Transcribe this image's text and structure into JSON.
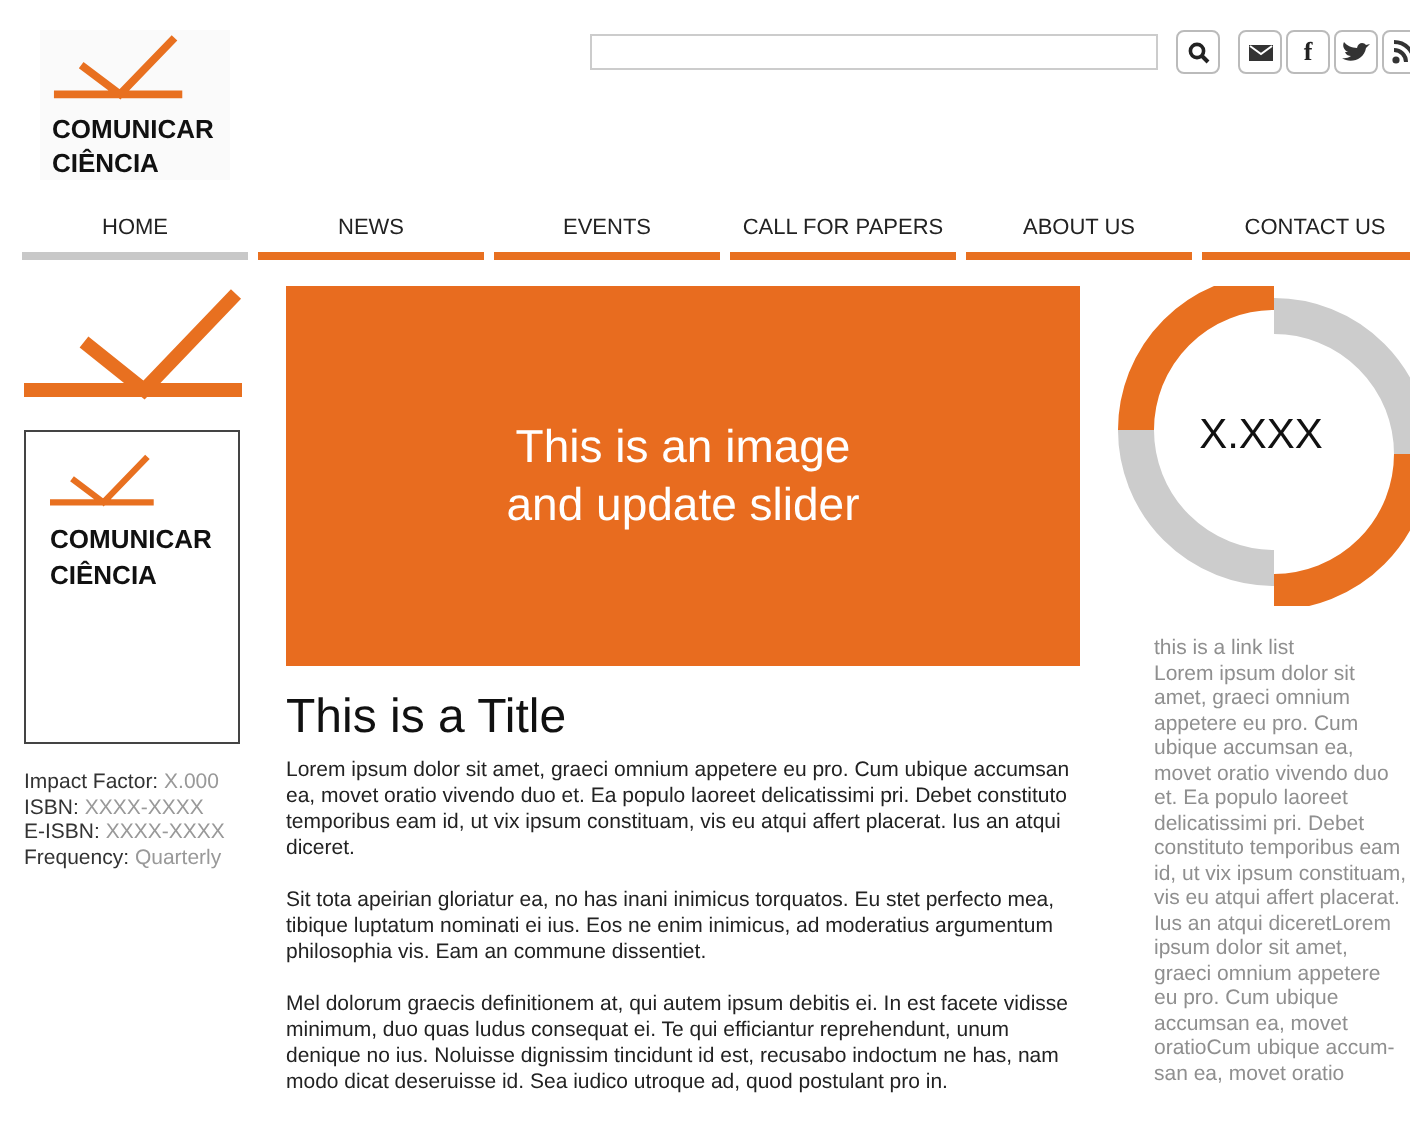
{
  "header": {
    "logo_text": "COMUNICAR CIÊNCIA",
    "social": [
      {
        "kind": "mail"
      },
      {
        "kind": "letter",
        "label": "f"
      },
      {
        "kind": "bird"
      },
      {
        "kind": "feed"
      }
    ]
  },
  "nav": [
    {
      "label": "HOME",
      "selected": true
    },
    {
      "label": "NEWS",
      "selected": false
    },
    {
      "label": "EVENTS",
      "selected": false
    },
    {
      "label": "CALL FOR PAPERS",
      "selected": false
    },
    {
      "label": "ABOUT US",
      "selected": false
    },
    {
      "label": "CONTACT US",
      "selected": false
    }
  ],
  "sidebar": {
    "cover_text": "COMUNICAR CIÊNCIA",
    "meta": [
      {
        "label": "Impact Factor:",
        "value": "X.000"
      },
      {
        "label": "ISBN:",
        "value": "XXXX-XXXX"
      },
      {
        "label": "E-ISBN:",
        "value": "XXXX-XXXX"
      },
      {
        "label": "Frequency:",
        "value": "Quarterly"
      }
    ]
  },
  "slider": {
    "text": "This is an image and update slider"
  },
  "article": {
    "title": "This is a Title",
    "paragraphs": [
      "Lorem ipsum dolor sit amet, graeci omnium appetere eu pro. Cum ubique accumsan ea, movet oratio vivendo duo et. Ea populo laoreet delicatissimi pri. Debet constituto temporibus eam id, ut vix ipsum constituam, vis eu atqui affert placerat. Ius an atqui diceret.",
      "Sit tota apeirian gloriatur ea, no has inani inimicus torquatos. Eu stet perfecto mea, tibique luptatum nominati ei ius. Eos ne enim inimicus, ad moderatius argumentum philosophia vis. Eam an commune dissentiet.",
      "Mel dolorum graecis definitionem at, qui autem ipsum debitis ei. In est facete vidisse minimum, duo quas ludus consequat ei. Te qui efficiantur reprehendunt, unum denique no ius. Noluisse dignissim tincidunt id est, recusabo indoctum ne has, nam modo dicat deseruisse id. Sea iudico utroque ad, quod postulant pro in."
    ]
  },
  "metric": {
    "value": "X.XXX"
  },
  "link_list": {
    "title": "this is a link list",
    "lines": [
      "Lorem ipsum dolor sit",
      "amet, graeci omnium",
      "appetere eu pro. Cum",
      "ubique accumsan ea,",
      "movet oratio vivendo duo",
      "et. Ea populo laoreet",
      "delicatissimi pri. Debet",
      "constituto temporibus eam",
      "id, ut vix ipsum constituam,",
      "vis eu atqui affert placerat.",
      "Ius an atqui diceretLorem",
      "ipsum dolor sit amet,",
      "graeci omnium appetere",
      "eu pro. Cum ubique",
      "accumsan ea, movet",
      "oratioCum ubique accum-",
      "san ea, movet oratio"
    ]
  }
}
